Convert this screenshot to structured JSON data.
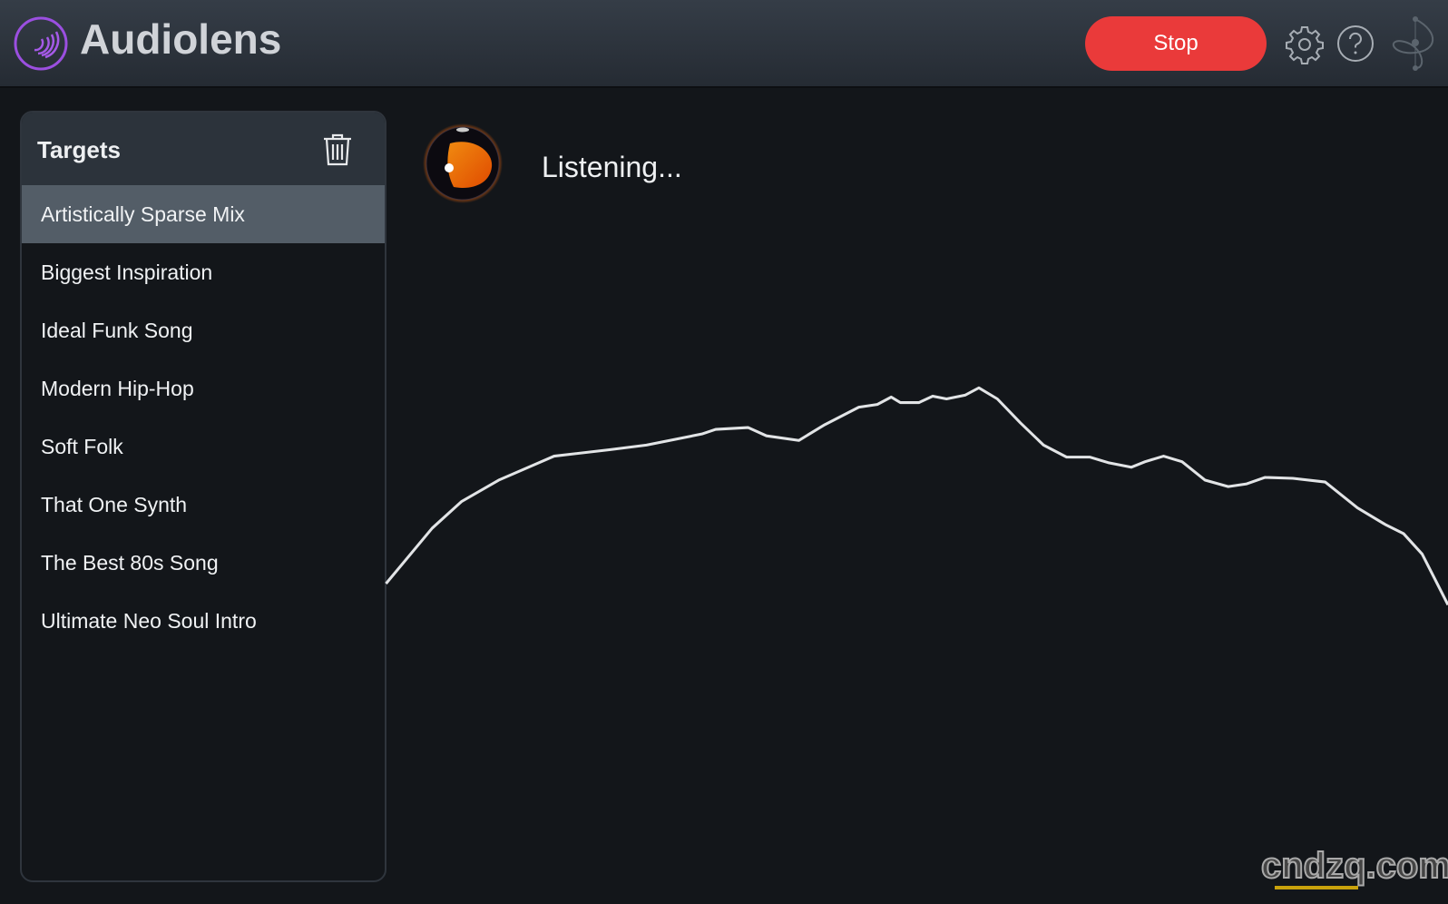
{
  "header": {
    "app_title": "Audiolens",
    "stop_label": "Stop",
    "icons": [
      "logo-icon",
      "gear-icon",
      "help-icon",
      "network-icon"
    ]
  },
  "targets": {
    "title": "Targets",
    "selected_index": 0,
    "items": [
      {
        "label": "Artistically Sparse Mix"
      },
      {
        "label": "Biggest Inspiration"
      },
      {
        "label": "Ideal Funk Song"
      },
      {
        "label": "Modern Hip-Hop"
      },
      {
        "label": "Soft Folk"
      },
      {
        "label": "That One Synth"
      },
      {
        "label": "The Best 80s Song"
      },
      {
        "label": "Ultimate Neo Soul Intro"
      }
    ]
  },
  "main": {
    "status": "Listening..."
  },
  "watermark": "cndzq.com",
  "colors": {
    "accent": "#ea3a3a",
    "logo": "#9b4fe0",
    "orb": "#e8620a"
  }
}
